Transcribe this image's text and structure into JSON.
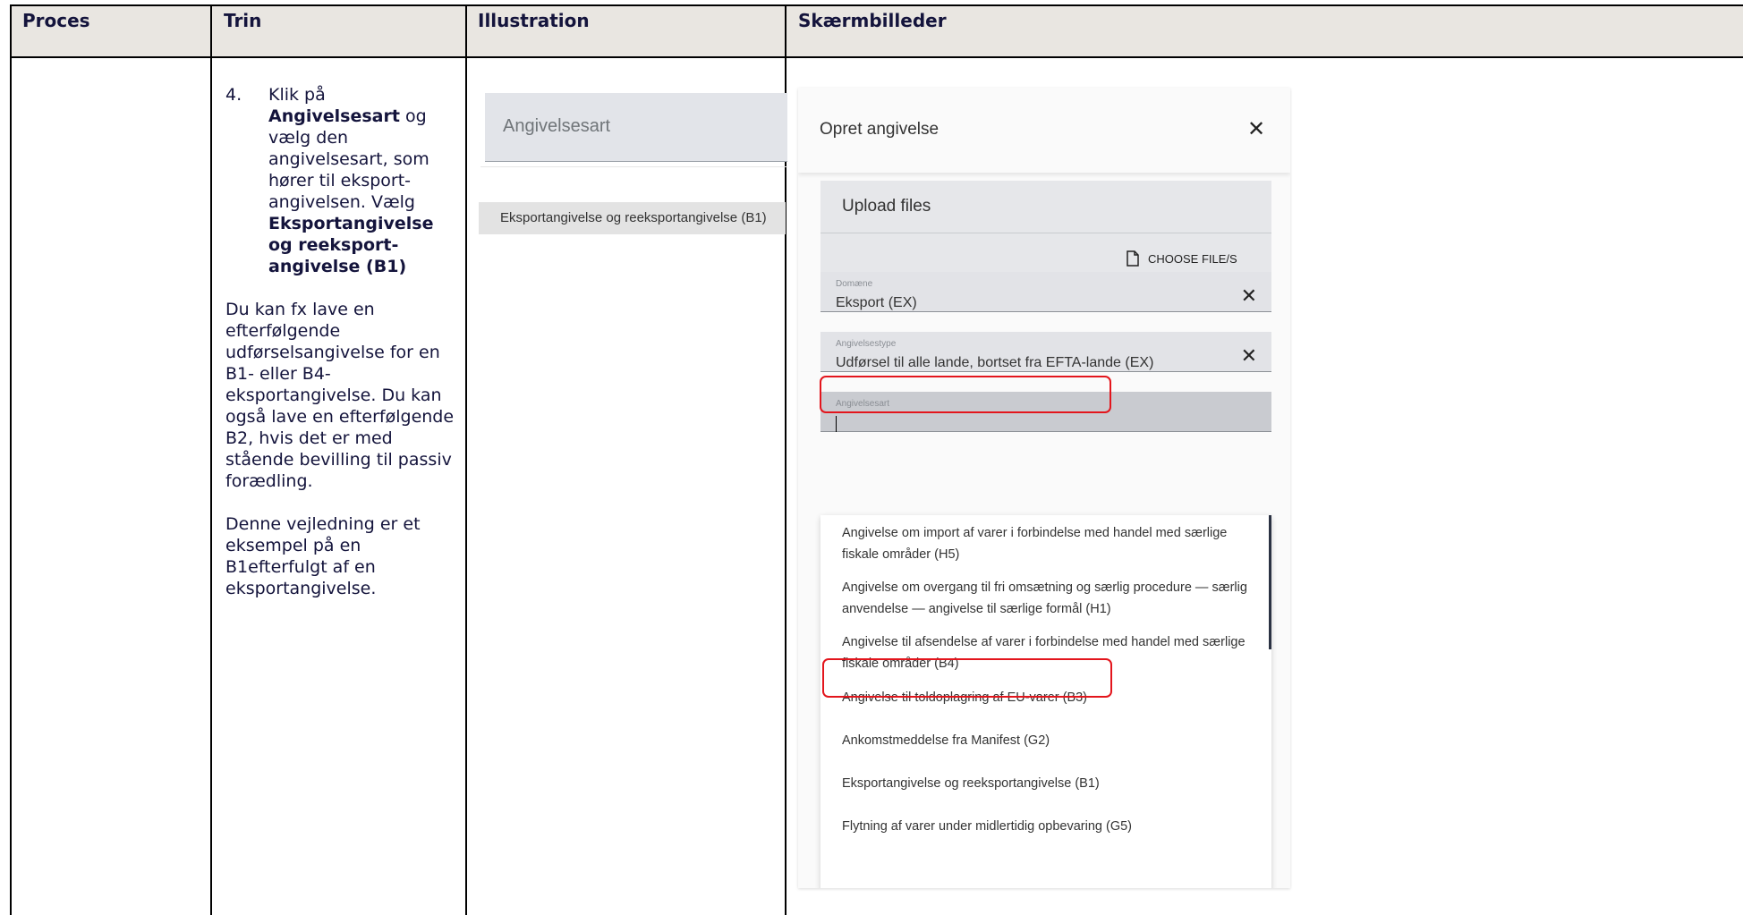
{
  "headers": {
    "proces": "Proces",
    "trin": "Trin",
    "illustration": "Illustration",
    "skaermbilleder": "Skærmbilleder"
  },
  "trin": {
    "step_number": "4.",
    "intro_1": "Klik på",
    "bold_1": "Angivelsesart",
    "intro_2": "og vælg den angivelsesart, som hører til eksport-angivelsen. Vælg",
    "bold_2": "Eksportangivelse og reeksport-angivelse (B1)",
    "note_1": "Du kan fx lave en efterfølgende udførselsangivelse for en B1- eller B4-eksportangivelse. Du kan også lave en efterfølgende B2, hvis det er med stående bevilling til passiv forædling.",
    "note_2": "Denne vejledning er et eksempel på en B1efterfulgt af en eksportangivelse."
  },
  "illustration": {
    "field_label": "Angivelsesart",
    "option_label": "Eksportangivelse og reeksportangivelse (B1)"
  },
  "dialog": {
    "title": "Opret angivelse",
    "upload": {
      "title": "Upload files",
      "choose_label": "CHOOSE FILE/S"
    },
    "fields": {
      "domaene": {
        "label": "Domæne",
        "value": "Eksport (EX)"
      },
      "angivelsestype": {
        "label": "Angivelsestype",
        "value": "Udførsel til alle lande, bortset fra EFTA-lande (EX)"
      },
      "angivelsesart": {
        "label": "Angivelsesart",
        "value": ""
      }
    },
    "options": [
      "Angivelse om import af varer i forbindelse med handel med særlige fiskale områder (H5)",
      "Angivelse om overgang til fri omsætning og særlig procedure — særlig anvendelse — angivelse til særlige formål (H1)",
      "Angivelse til afsendelse af varer i forbindelse med handel med særlige fiskale områder (B4)",
      "Angivelse til toldoplagring af EU-varer (B3)",
      "Ankomstmeddelse fra Manifest (G2)",
      "Eksportangivelse og reeksportangivelse (B1)",
      "Flytning af varer under midlertidig opbevaring (G5)"
    ]
  },
  "colors": {
    "highlight": "#e3151c",
    "header_bg": "#e9e6e1",
    "heading_text": "#14143c"
  }
}
